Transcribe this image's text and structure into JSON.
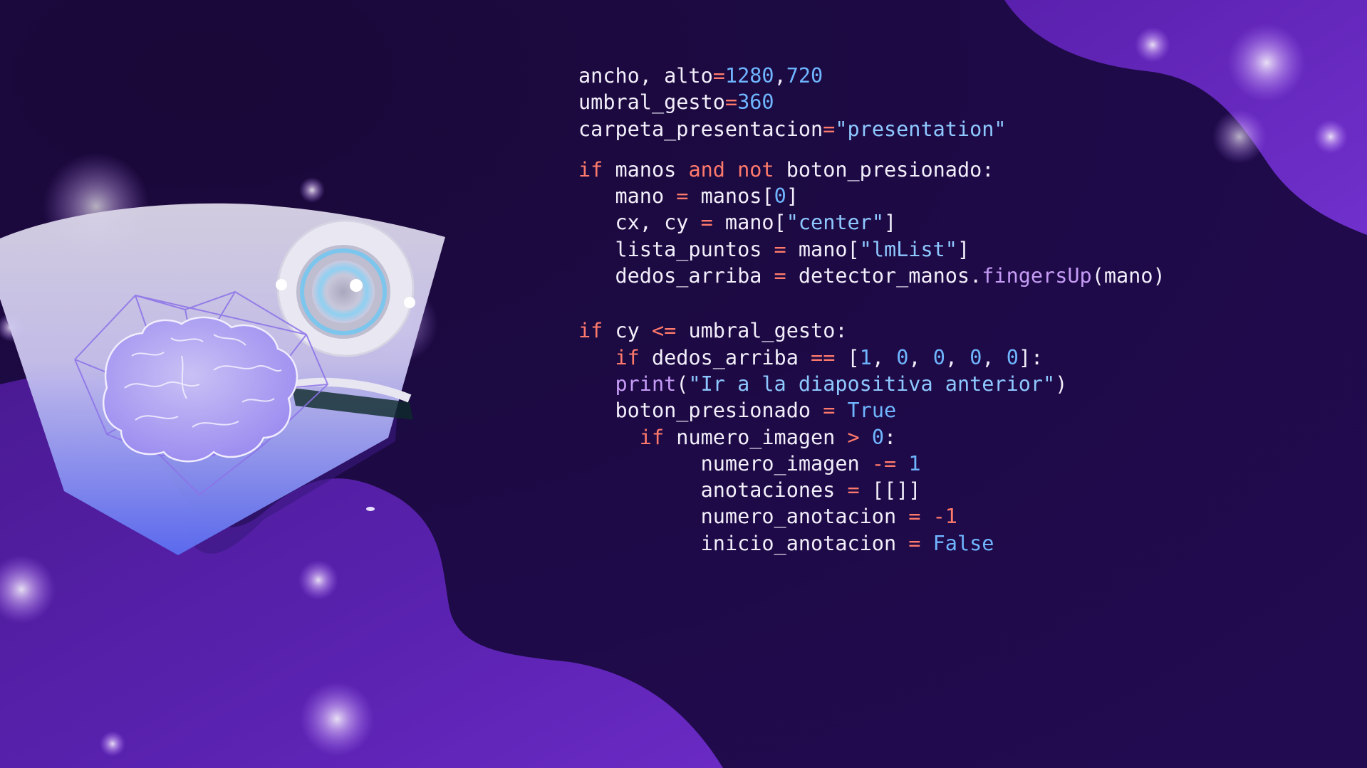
{
  "code": {
    "lines": [
      {
        "indent": "",
        "tokens": [
          {
            "t": "ancho, alto",
            "c": ""
          },
          {
            "t": "=",
            "c": "op"
          },
          {
            "t": "1280",
            "c": "num"
          },
          {
            "t": ",",
            "c": ""
          },
          {
            "t": "720",
            "c": "num"
          }
        ]
      },
      {
        "indent": "",
        "tokens": [
          {
            "t": "umbral_gesto",
            "c": ""
          },
          {
            "t": "=",
            "c": "op"
          },
          {
            "t": "360",
            "c": "num"
          }
        ]
      },
      {
        "indent": "",
        "tokens": [
          {
            "t": "carpeta_presentacion",
            "c": ""
          },
          {
            "t": "=",
            "c": "op"
          },
          {
            "t": "\"presentation\"",
            "c": "str"
          }
        ]
      },
      {
        "gap": true
      },
      {
        "indent": "",
        "tokens": [
          {
            "t": "if",
            "c": "kw"
          },
          {
            "t": " manos ",
            "c": ""
          },
          {
            "t": "and",
            "c": "kw"
          },
          {
            "t": " ",
            "c": ""
          },
          {
            "t": "not",
            "c": "kw"
          },
          {
            "t": " boton_presionado:",
            "c": ""
          }
        ]
      },
      {
        "indent": "   ",
        "tokens": [
          {
            "t": "mano ",
            "c": ""
          },
          {
            "t": "=",
            "c": "op"
          },
          {
            "t": " manos[",
            "c": ""
          },
          {
            "t": "0",
            "c": "num"
          },
          {
            "t": "]",
            "c": ""
          }
        ]
      },
      {
        "indent": "   ",
        "tokens": [
          {
            "t": "cx, cy ",
            "c": ""
          },
          {
            "t": "=",
            "c": "op"
          },
          {
            "t": " mano[",
            "c": ""
          },
          {
            "t": "\"center\"",
            "c": "str"
          },
          {
            "t": "]",
            "c": ""
          }
        ]
      },
      {
        "indent": "   ",
        "tokens": [
          {
            "t": "lista_puntos ",
            "c": ""
          },
          {
            "t": "=",
            "c": "op"
          },
          {
            "t": " mano[",
            "c": ""
          },
          {
            "t": "\"lmList\"",
            "c": "str"
          },
          {
            "t": "]",
            "c": ""
          }
        ]
      },
      {
        "indent": "   ",
        "tokens": [
          {
            "t": "dedos_arriba ",
            "c": ""
          },
          {
            "t": "=",
            "c": "op"
          },
          {
            "t": " detector_manos.",
            "c": ""
          },
          {
            "t": "fingersUp",
            "c": "fn"
          },
          {
            "t": "(mano)",
            "c": ""
          }
        ]
      },
      {
        "gap": true
      },
      {
        "gap": true
      },
      {
        "indent": "",
        "tokens": [
          {
            "t": "if",
            "c": "kw"
          },
          {
            "t": " cy ",
            "c": ""
          },
          {
            "t": "<=",
            "c": "op"
          },
          {
            "t": " umbral_gesto:",
            "c": ""
          }
        ]
      },
      {
        "indent": "   ",
        "tokens": [
          {
            "t": "if",
            "c": "kw"
          },
          {
            "t": " dedos_arriba ",
            "c": ""
          },
          {
            "t": "==",
            "c": "op"
          },
          {
            "t": " [",
            "c": ""
          },
          {
            "t": "1",
            "c": "num"
          },
          {
            "t": ", ",
            "c": ""
          },
          {
            "t": "0",
            "c": "num"
          },
          {
            "t": ", ",
            "c": ""
          },
          {
            "t": "0",
            "c": "num"
          },
          {
            "t": ", ",
            "c": ""
          },
          {
            "t": "0",
            "c": "num"
          },
          {
            "t": ", ",
            "c": ""
          },
          {
            "t": "0",
            "c": "num"
          },
          {
            "t": "]:",
            "c": ""
          }
        ]
      },
      {
        "indent": "   ",
        "tokens": [
          {
            "t": "print",
            "c": "fn"
          },
          {
            "t": "(",
            "c": ""
          },
          {
            "t": "\"Ir a la diapositiva anterior\"",
            "c": "str"
          },
          {
            "t": ")",
            "c": ""
          }
        ]
      },
      {
        "indent": "   ",
        "tokens": [
          {
            "t": "boton_presionado ",
            "c": ""
          },
          {
            "t": "=",
            "c": "op"
          },
          {
            "t": " ",
            "c": ""
          },
          {
            "t": "True",
            "c": "bool"
          }
        ]
      },
      {
        "indent": "     ",
        "tokens": [
          {
            "t": "if",
            "c": "kw"
          },
          {
            "t": " numero_imagen ",
            "c": ""
          },
          {
            "t": ">",
            "c": "op"
          },
          {
            "t": " ",
            "c": ""
          },
          {
            "t": "0",
            "c": "num"
          },
          {
            "t": ":",
            "c": ""
          }
        ]
      },
      {
        "indent": "          ",
        "tokens": [
          {
            "t": "numero_imagen ",
            "c": ""
          },
          {
            "t": "-=",
            "c": "op"
          },
          {
            "t": " ",
            "c": ""
          },
          {
            "t": "1",
            "c": "num"
          }
        ]
      },
      {
        "indent": "          ",
        "tokens": [
          {
            "t": "anotaciones ",
            "c": ""
          },
          {
            "t": "=",
            "c": "op"
          },
          {
            "t": " [[]]",
            "c": ""
          }
        ]
      },
      {
        "indent": "          ",
        "tokens": [
          {
            "t": "numero_anotacion ",
            "c": ""
          },
          {
            "t": "=",
            "c": "op"
          },
          {
            "t": " ",
            "c": ""
          },
          {
            "t": "-1",
            "c": "op"
          }
        ]
      },
      {
        "indent": "          ",
        "tokens": [
          {
            "t": "inicio_anotacion ",
            "c": ""
          },
          {
            "t": "=",
            "c": "op"
          },
          {
            "t": " ",
            "c": ""
          },
          {
            "t": "False",
            "c": "bool"
          }
        ]
      }
    ]
  },
  "colors": {
    "background": "#1d0a45",
    "blob": "#5b22b0",
    "keyword": "#ff7a6b",
    "number": "#6fb6ff",
    "string": "#8ec8ff",
    "function": "#c69cf6",
    "text": "#f2eefa"
  },
  "illustration": {
    "icons": [
      "webcam-icon",
      "brain-icon"
    ]
  }
}
